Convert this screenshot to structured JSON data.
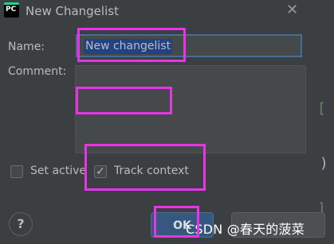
{
  "window": {
    "title": "New Changelist",
    "app_icon_text": "PC",
    "close_glyph": "✕"
  },
  "form": {
    "name_label": "Name:",
    "name_value": "New changelist",
    "comment_label": "Comment:",
    "set_active_label": "Set active",
    "set_active_checked": false,
    "track_context_label": "Track context",
    "track_context_checked": true
  },
  "buttons": {
    "help_label": "?",
    "ok_label": "OK",
    "cancel_label": ""
  },
  "background_code": {
    "text_1": "[",
    "text_2": ")",
    "text_3": "]"
  },
  "watermark": "CSDN @春天的菠菜",
  "colors": {
    "background": "#3c3f41",
    "input_focus_border": "#466d94",
    "selection": "#214283",
    "ok_button": "#365880",
    "annotation_highlight": "#e634e6"
  }
}
